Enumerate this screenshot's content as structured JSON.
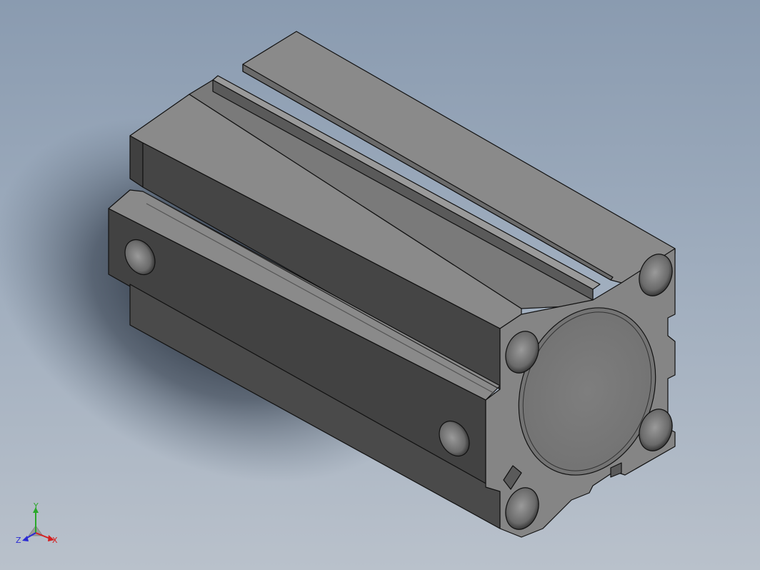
{
  "viewport": {
    "background_top": "#8a9bb0",
    "background_bottom": "#b9c1cb"
  },
  "model": {
    "name": "compact-air-cylinder",
    "body_color": "#6e6e6e",
    "face_color": "#8a8a8a",
    "edge_color": "#111111"
  },
  "triad": {
    "x_label": "X",
    "y_label": "Y",
    "z_label": "Z",
    "x_color": "#d42020",
    "y_color": "#2aa82a",
    "z_color": "#2a2ad4"
  }
}
